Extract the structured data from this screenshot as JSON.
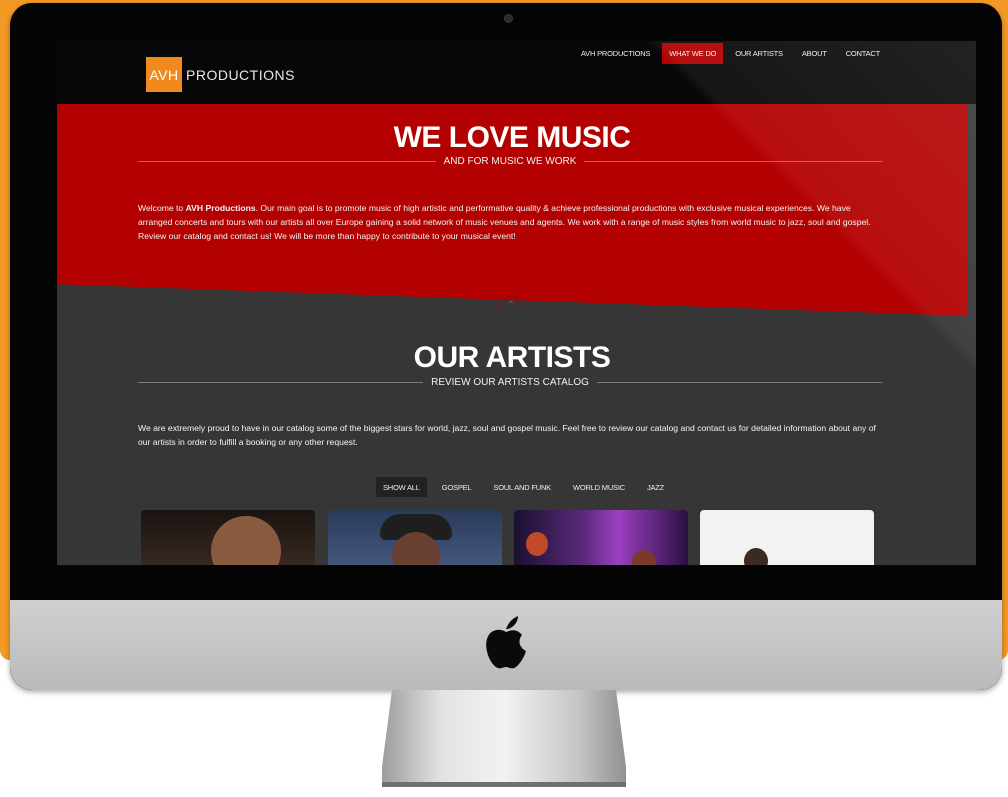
{
  "site": {
    "logo_box": "AVH",
    "logo_text": "PRODUCTIONS"
  },
  "nav": {
    "items": [
      {
        "label": "AVH PRODUCTIONS",
        "active": false
      },
      {
        "label": "WHAT WE DO",
        "active": true
      },
      {
        "label": "OUR ARTISTS",
        "active": false
      },
      {
        "label": "ABOUT",
        "active": false
      },
      {
        "label": "CONTACT",
        "active": false
      }
    ]
  },
  "hero": {
    "title": "WE LOVE MUSIC",
    "subtitle": "AND FOR MUSIC WE WORK",
    "intro_prefix": "Welcome to ",
    "intro_brand": "AVH Productions",
    "intro_body": ". Our main goal is to promote music of high artistic and performative quality & achieve professional productions with exclusive musical experiences. We have arranged concerts and tours with our artists  all over Europe gaining a solid network of music venues and agents. We work with a range of music styles from world music to jazz, soul and gospel. Review our catalog and contact us! We will be more than happy to contribute to your musical event!"
  },
  "artists": {
    "title": "OUR ARTISTS",
    "subtitle": "REVIEW OUR ARTISTS CATALOG",
    "description": "We are extremely proud to have in our catalog some of the biggest stars for world, jazz, soul and gospel music. Feel free to review our catalog and contact us for detailed information about any of our artists in order to fulfill a booking or any other request.",
    "filters": [
      "SHOW ALL",
      "GOSPEL",
      "SOUL AND FUNK",
      "WORLD MUSIC",
      "JAZZ"
    ],
    "active_filter": "SHOW ALL"
  },
  "icons": {
    "scroll": "chevron-up-icon",
    "brand": "apple-logo-icon"
  },
  "colors": {
    "accent_red": "#b30000",
    "logo_orange": "#f08a1c",
    "backdrop_orange": "#f39a26",
    "page_dark": "#363636"
  }
}
